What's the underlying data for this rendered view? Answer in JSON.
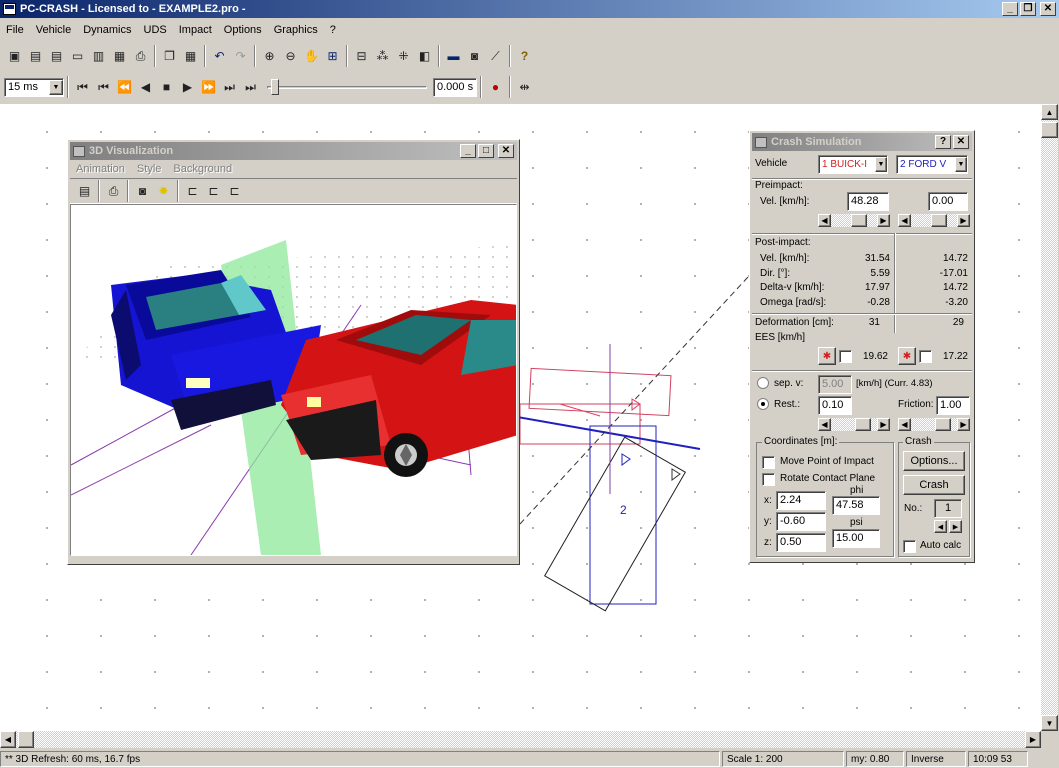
{
  "window": {
    "title": "PC-CRASH - Licensed to  -  EXAMPLE2.pro -"
  },
  "menu": [
    "File",
    "Vehicle",
    "Dynamics",
    "UDS",
    "Impact",
    "Options",
    "Graphics",
    "?"
  ],
  "toolbar2": {
    "time_step": "15 ms",
    "time_value": "0.000 s"
  },
  "viz": {
    "title": "3D Visualization",
    "menu": [
      "Animation",
      "Style",
      "Background"
    ]
  },
  "crash": {
    "title": "Crash Simulation",
    "help_btn": "?",
    "vehicle_label": "Vehicle",
    "vehicle1": "1 BUICK-I",
    "vehicle2": "2 FORD V",
    "preimpact_label": "Preimpact:",
    "vel_label": "Vel. [km/h]:",
    "vel1": "48.28",
    "vel2": "0.00",
    "postimpact_label": "Post-impact:",
    "post_rows": [
      {
        "label": "Vel. [km/h]:",
        "v1": "31.54",
        "v2": "14.72"
      },
      {
        "label": "Dir. [°]:",
        "v1": "5.59",
        "v2": "-17.01"
      },
      {
        "label": "Delta-v [km/h]:",
        "v1": "17.97",
        "v2": "14.72"
      },
      {
        "label": "Omega [rad/s]:",
        "v1": "-0.28",
        "v2": "-3.20"
      }
    ],
    "deformation_label": "Deformation [cm]:",
    "def1": "31",
    "def2": "29",
    "ees_label": "EES [km/h]",
    "ees1": "19.62",
    "ees2": "17.22",
    "sep_label": "sep. v:",
    "sep_value": "5.00",
    "sep_unit": "[km/h] (Curr. 4.83)",
    "rest_label": "Rest.:",
    "rest_value": "0.10",
    "friction_label": "Friction:",
    "friction_value": "1.00",
    "coords_title": "Coordinates [m]:",
    "move_poi": "Move Point of Impact",
    "rotate_cp": "Rotate Contact Plane",
    "x_label": "x:",
    "x_value": "2.24",
    "y_label": "y:",
    "y_value": "-0.60",
    "z_label": "z:",
    "z_value": "0.50",
    "phi_label": "phi",
    "phi_value": "47.58",
    "psi_label": "psi",
    "psi_value": "15.00",
    "crash_title": "Crash",
    "options_btn": "Options...",
    "crash_btn": "Crash",
    "no_label": "No.:",
    "no_value": "1",
    "auto_calc": "Auto calc"
  },
  "status": {
    "refresh": "** 3D Refresh: 60 ms, 16.7 fps",
    "scale": "Scale 1: 200",
    "my": "my: 0.80",
    "inverse": "Inverse",
    "time": "10:09 53"
  },
  "colors": {
    "titlebar": "#0a246a",
    "car1": "#1414d2",
    "car2": "#d41414",
    "contact_plane": "#8ee89a"
  }
}
